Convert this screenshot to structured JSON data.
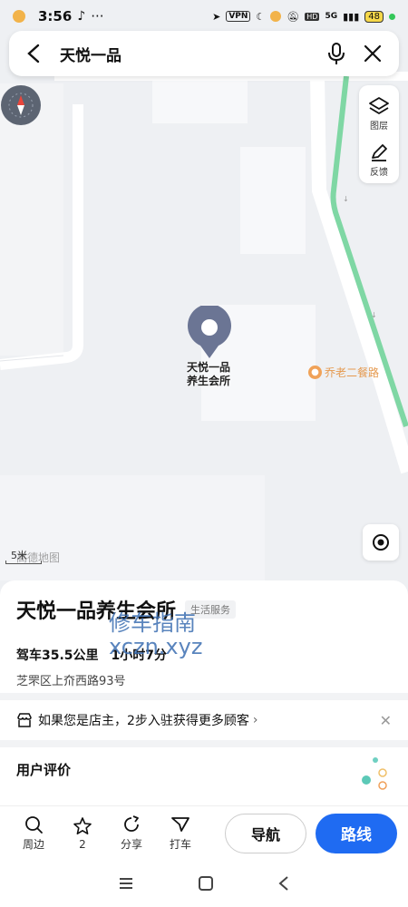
{
  "status_bar": {
    "time": "3:56",
    "vpn": "VPN",
    "network": "5G",
    "battery": "48"
  },
  "search": {
    "query": "天悦一品"
  },
  "map_tools": {
    "layers_label": "图层",
    "feedback_label": "反馈"
  },
  "map": {
    "pin_label_line1": "天悦一品",
    "pin_label_line2": "养生会所",
    "poi_name": "乔老二餐路",
    "scale_text": "5米",
    "map_logo": "高德地图"
  },
  "place": {
    "name": "天悦一品养生会所",
    "category": "生活服务",
    "drive_info": "驾车35.5公里",
    "drive_time": "1小时7分",
    "address": "芝罘区上夼西路93号",
    "watermark_line1": "修车指南",
    "watermark_line2": "xczn.xyz"
  },
  "promo": {
    "text": "如果您是店主，2步入驻获得更多顾客"
  },
  "reviews": {
    "title": "用户评价"
  },
  "actions": {
    "nearby": "周边",
    "favorite_count": "2",
    "share": "分享",
    "taxi": "打车",
    "navigate": "导航",
    "route": "路线"
  },
  "colors": {
    "accent": "#1f6bf2",
    "road_green": "#7fd7a4",
    "pin": "#6b7594",
    "poi": "#f0a258"
  }
}
